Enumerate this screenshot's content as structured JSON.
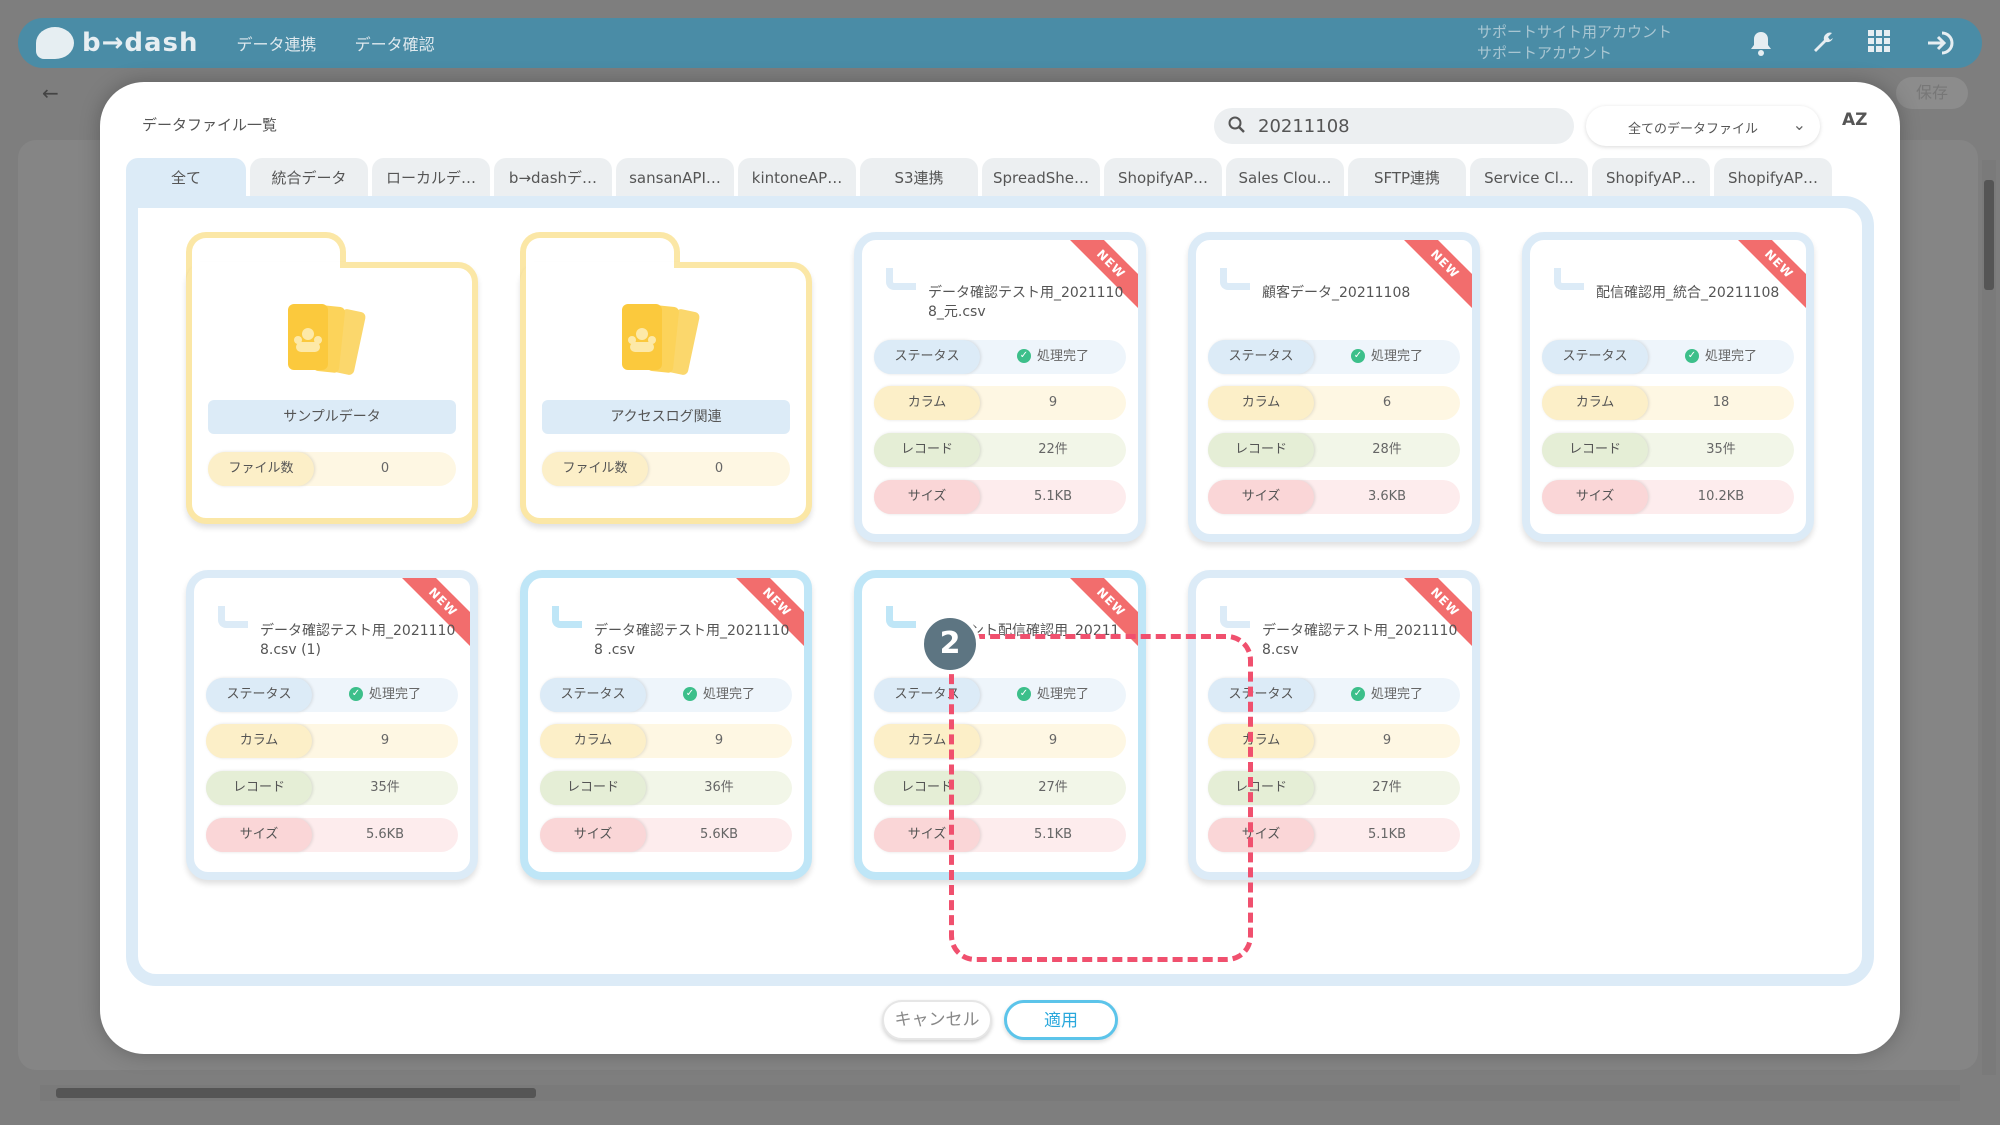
{
  "app": {
    "logo_text": "b→dash",
    "nav": [
      "データ連携",
      "データ確認"
    ],
    "account_line1": "サポートサイト用アカウント",
    "account_line2": "サポートアカウント",
    "save_label": "保存",
    "back_label": "←"
  },
  "modal": {
    "title": "データファイル一覧",
    "search_value": "20211108",
    "filter_label": "全てのデータファイル",
    "sort_label": "AZ"
  },
  "tabs": [
    "全て",
    "統合データ",
    "ローカルデ…",
    "b→dashデ…",
    "sansanAPI…",
    "kintoneAP…",
    "S3連携",
    "SpreadShe…",
    "ShopifyAP…",
    "Sales Clou…",
    "SFTP連携",
    "Service Cl…",
    "ShopifyAP…",
    "ShopifyAP…"
  ],
  "labels": {
    "file_count": "ファイル数",
    "status": "ステータス",
    "columns": "カラム",
    "records": "レコード",
    "size": "サイズ",
    "new": "NEW",
    "check": "✓"
  },
  "folders": [
    {
      "name": "サンプルデータ",
      "count": "0"
    },
    {
      "name": "アクセスログ関連",
      "count": "0"
    }
  ],
  "files": [
    {
      "name": "データ確認テスト用_20211108_元.csv",
      "status": "処理完了",
      "columns": "9",
      "records": "22件",
      "size": "5.1KB"
    },
    {
      "name": "顧客データ_20211108",
      "status": "処理完了",
      "columns": "6",
      "records": "28件",
      "size": "3.6KB"
    },
    {
      "name": "配信確認用_統合_20211108",
      "status": "処理完了",
      "columns": "18",
      "records": "35件",
      "size": "10.2KB"
    },
    {
      "name": "データ確認テスト用_20211108.csv (1)",
      "status": "処理完了",
      "columns": "9",
      "records": "35件",
      "size": "5.6KB"
    },
    {
      "name": "データ確認テスト用_20211108 .csv",
      "status": "処理完了",
      "columns": "9",
      "records": "36件",
      "size": "5.6KB"
    },
    {
      "name": "セグメント配信確認用_20211108",
      "status": "処理完了",
      "columns": "9",
      "records": "27件",
      "size": "5.1KB"
    },
    {
      "name": "データ確認テスト用_20211108.csv",
      "status": "処理完了",
      "columns": "9",
      "records": "27件",
      "size": "5.1KB"
    }
  ],
  "step_badge": "2",
  "buttons": {
    "cancel": "キャンセル",
    "apply": "適用"
  },
  "colors": {
    "accent": "#5cc4ea",
    "new_ribbon": "#f26d6d",
    "highlight": "#f0506e",
    "folder_border": "#fbe7a6",
    "card_border": "#dcebf7"
  }
}
